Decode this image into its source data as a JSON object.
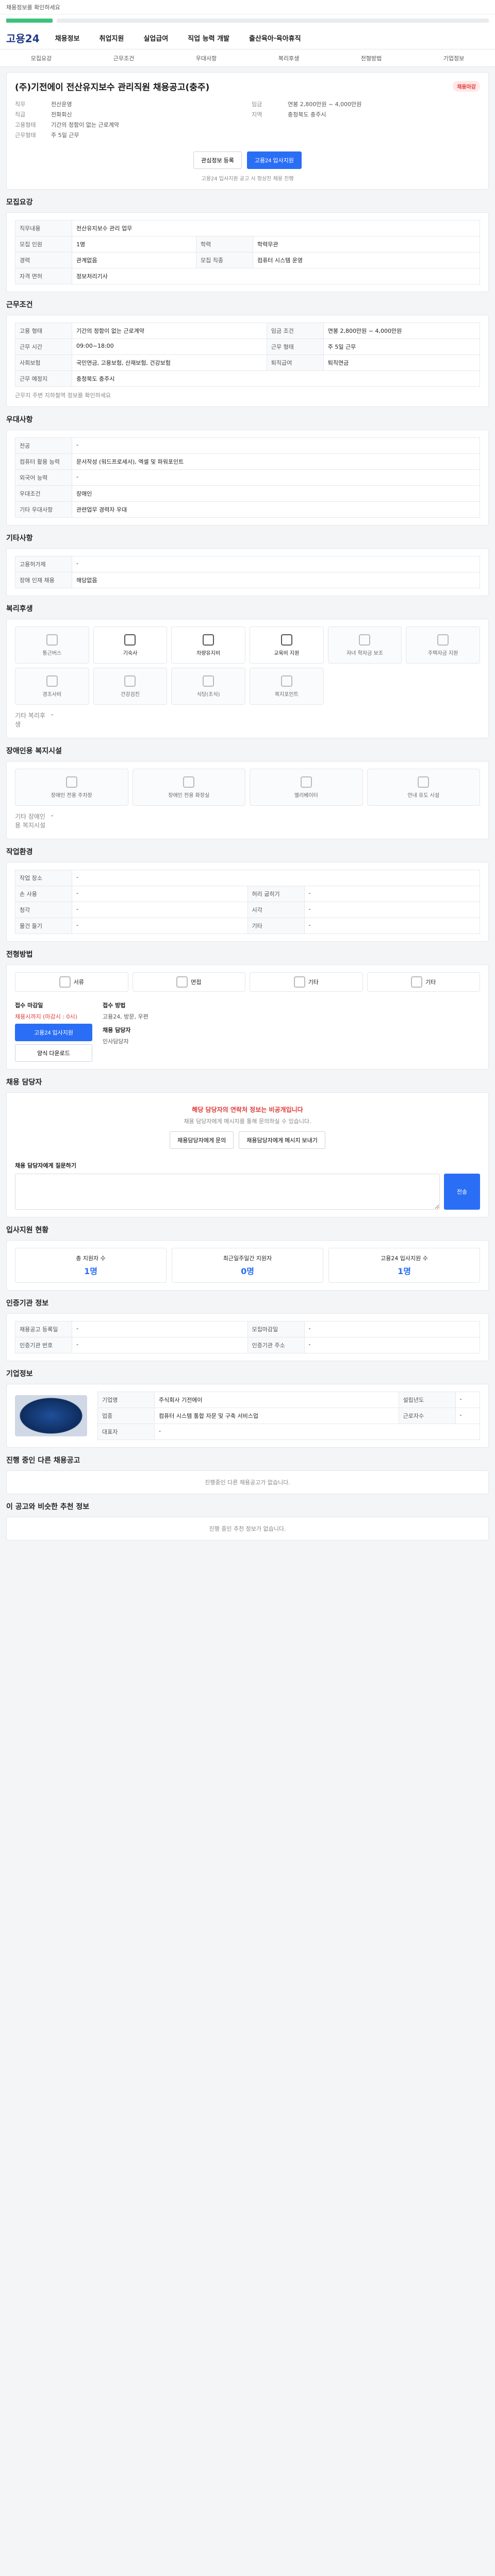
{
  "topbar": {
    "notice": "채용정보를 확인하세요"
  },
  "gnb": {
    "logo": "고용24",
    "menu": [
      "채용정보",
      "취업지원",
      "실업급여",
      "직업 능력 개발",
      "출산육아·육아휴직"
    ]
  },
  "subnav": [
    "모집요강",
    "근무조건",
    "우대사항",
    "복리후생",
    "전형방법",
    "기업정보"
  ],
  "job": {
    "title": "(주)기전에이 전산유지보수 관리직원 채용공고(충주)",
    "badge": "채용마감",
    "company_label": "직종코드",
    "meta_left": [
      {
        "k": "직무",
        "v": "전산운영"
      },
      {
        "k": "직급",
        "v": "전화회신"
      }
    ],
    "meta_right": [
      {
        "k": "임금",
        "v": "연봉 2,800만원 ~ 4,000만원"
      },
      {
        "k": "지역",
        "v": "충청북도 충주시"
      }
    ],
    "condition": [
      {
        "k": "고용형태",
        "v": "기간의 정함이 없는 근로계약"
      },
      {
        "k": "근무형태",
        "v": "주 5일 근무"
      }
    ],
    "btn_interest": "관심정보 등록",
    "btn_apply": "고용24 입사지원",
    "note": "고용24 입사지원 공고 시 정상진 채용 진행"
  },
  "recruit": {
    "title": "모집요강",
    "rows": [
      {
        "k": "직무내용",
        "v": "전산유지보수 관리 업무"
      },
      {
        "k": "모집 인원",
        "v": "1명"
      },
      {
        "k": "학력",
        "v": "학력무관"
      },
      {
        "k": "경력",
        "v": "관계없음"
      },
      {
        "k": "모집 직종",
        "v": "컴퓨터 시스템 운영"
      },
      {
        "k": "자격 면허",
        "v": "정보처리기사"
      }
    ]
  },
  "work": {
    "title": "근무조건",
    "rows": [
      {
        "k": "고용 형태",
        "v": "기간의 정함이 없는 근로계약"
      },
      {
        "k": "임금 조건",
        "v": "연봉 2,800만원 ~ 4,000만원"
      },
      {
        "k": "근무 시간",
        "v": "09:00~18:00"
      },
      {
        "k": "근무 형태",
        "v": "주 5일 근무"
      },
      {
        "k": "사회보험",
        "v": "국민연금, 고용보험, 산재보험, 건강보험"
      },
      {
        "k": "퇴직급여",
        "v": "퇴직연금"
      },
      {
        "k": "근무 예정지",
        "v": "충청북도 충주시"
      }
    ],
    "note": "근무지 주변 지하철역 정보를 확인하세요"
  },
  "pref": {
    "title": "우대사항",
    "rows": [
      {
        "k": "전공",
        "v": "-"
      },
      {
        "k": "컴퓨터 활용 능력",
        "v": "문서작성 (워드프로세서), 엑셀 및 파워포인트"
      },
      {
        "k": "외국어 능력",
        "v": "-"
      },
      {
        "k": "우대조건",
        "v": "장애인"
      },
      {
        "k": "기타 우대사항",
        "v": "관련업무 경력자 우대"
      }
    ]
  },
  "etc": {
    "title": "기타사항",
    "rows": [
      {
        "k": "고용허가제",
        "v": "-"
      },
      {
        "k": "장애 인재 채용",
        "v": "해당없음"
      }
    ]
  },
  "welfare": {
    "title": "복리후생",
    "items": [
      "통근버스",
      "기숙사",
      "차량유지비",
      "교육비 지원",
      "자녀 학자금 보조",
      "주택자금 지원",
      "경조사비",
      "건강검진",
      "식당(조식)",
      "복지포인트"
    ],
    "other_label": "기타 복리후생",
    "other_value": "-"
  },
  "disabled": {
    "title": "장애인용 복지시설",
    "items": [
      "장애인 전용 주차장",
      "장애인 전용 화장실",
      "엘리베이터",
      "안내 유도 시설"
    ],
    "other_label": "기타 장애인용 복지시설",
    "other_value": "-"
  },
  "place": {
    "title": "작업환경",
    "rows": [
      {
        "k": "작업 장소",
        "v": "-"
      },
      {
        "k": "손 사용",
        "v": "-"
      },
      {
        "k": "허리 굽히기",
        "v": "-"
      },
      {
        "k": "청각",
        "v": "-"
      },
      {
        "k": "시각",
        "v": "-"
      },
      {
        "k": "물건 들기",
        "v": "-"
      },
      {
        "k": "기타",
        "v": "-"
      }
    ]
  },
  "apply": {
    "title": "전형방법",
    "methods": [
      "서류",
      "면접",
      "기타",
      "기타"
    ],
    "period_title": "접수 마감일",
    "deadline": "채용시까지 (마감시 : 0시)",
    "btn_apply": "고용24 입사지원",
    "btn_doc": "양식 다운로드",
    "doc_title": "접수 방법",
    "doc_value": "고용24, 방문, 우편",
    "contact_title": "채용 담당자",
    "contact_value": "인사담당자"
  },
  "qa": {
    "title": "채용 담당자",
    "alert": "해당 담당자의 연락처 정보는 비공개입니다",
    "desc": "채용 담당자에게 메시지를 통해 문의하실 수 있습니다.",
    "btn1": "채용담당자에게 문의",
    "btn2": "채용담당자에게 메시지 보내기",
    "input_label": "채용 담당자에게 질문하기",
    "send": "전송"
  },
  "stats": {
    "title": "입사지원 현황",
    "items": [
      {
        "label": "총 지원자 수",
        "value": "1명"
      },
      {
        "label": "최근일주일간 지원자",
        "value": "0명"
      },
      {
        "label": "고용24 입사지원 수",
        "value": "1명"
      }
    ]
  },
  "info": {
    "title": "인증기관 정보",
    "rows": [
      {
        "k": "채용공고 등록일",
        "v": "-"
      },
      {
        "k": "모집마감일",
        "v": "-"
      },
      {
        "k": "인증기관 번호",
        "v": "-"
      },
      {
        "k": "인증기관 주소",
        "v": "-"
      }
    ]
  },
  "company": {
    "title": "기업정보",
    "rows": [
      {
        "k": "기업명",
        "v": "주식회사 기전에이"
      },
      {
        "k": "업종",
        "v": "컴퓨터 시스템 통합 자문 및 구축 서비스업"
      },
      {
        "k": "대표자",
        "v": "-"
      },
      {
        "k": "설립년도",
        "v": "-"
      },
      {
        "k": "근로자수",
        "v": "-"
      }
    ]
  },
  "other": {
    "title": "진행 중인 다른 채용공고",
    "note": "진행중인 다른 채용공고가 없습니다."
  },
  "recommend": {
    "title": "이 공고와 비슷한 추천 정보",
    "note": "진행 중인 추천 정보가 없습니다."
  }
}
